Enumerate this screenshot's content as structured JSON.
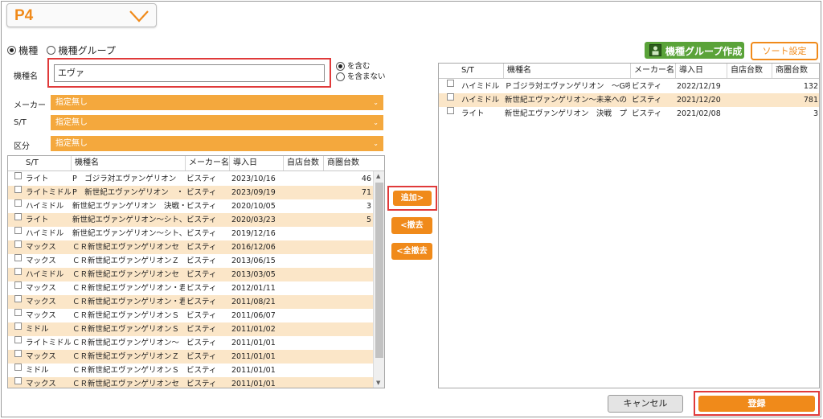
{
  "top_selector": {
    "value": "P4"
  },
  "mode": {
    "options": [
      "機種",
      "機種グループ"
    ],
    "selected": 0
  },
  "name_field": {
    "label": "機種名",
    "value": "エヴァ"
  },
  "match": {
    "options": [
      "を含む",
      "を含まない"
    ],
    "selected": 0
  },
  "filters": [
    {
      "label": "メーカー",
      "value": "指定無し"
    },
    {
      "label": "S/T",
      "value": "指定無し"
    },
    {
      "label": "区分",
      "value": "指定無し"
    }
  ],
  "left_table": {
    "columns": [
      "S/T",
      "機種名",
      "メーカー名",
      "導入日",
      "自店台数",
      "商圏台数"
    ],
    "rows": [
      [
        "ライト",
        "P　ゴジラ対エヴァンゲリオン",
        "ビスティ",
        "2023/10/16",
        "",
        "46"
      ],
      [
        "ライトミドル",
        "P　新世紀エヴァンゲリオン　・",
        "ビスティ",
        "2023/09/19",
        "",
        "71"
      ],
      [
        "ハイミドル",
        "新世紀エヴァンゲリオン　決戦・",
        "ビスティ",
        "2020/10/05",
        "",
        "3"
      ],
      [
        "ライト",
        "新世紀エヴァンゲリオン～シト、",
        "ビスティ",
        "2020/03/23",
        "",
        "5"
      ],
      [
        "ハイミドル",
        "新世紀エヴァンゲリオン～シト、",
        "ビスティ",
        "2019/12/16",
        "",
        ""
      ],
      [
        "マックス",
        "ＣＲ新世紀エヴァンゲリオンセ",
        "ビスティ",
        "2016/12/06",
        "",
        ""
      ],
      [
        "マックス",
        "ＣＲ新世紀エヴァンゲリオンＺ",
        "ビスティ",
        "2013/06/15",
        "",
        ""
      ],
      [
        "ハイミドル",
        "ＣＲ新世紀エヴァンゲリオンセ",
        "ビスティ",
        "2013/03/05",
        "",
        ""
      ],
      [
        "マックス",
        "ＣＲ新世紀エヴァンゲリオン・君",
        "ビスティ",
        "2012/01/11",
        "",
        ""
      ],
      [
        "マックス",
        "ＣＲ新世紀エヴァンゲリオン・君",
        "ビスティ",
        "2011/08/21",
        "",
        ""
      ],
      [
        "マックス",
        "ＣＲ新世紀エヴァンゲリオンＳ",
        "ビスティ",
        "2011/06/07",
        "",
        ""
      ],
      [
        "ミドル",
        "ＣＲ新世紀エヴァンゲリオンＳ",
        "ビスティ",
        "2011/01/02",
        "",
        ""
      ],
      [
        "ライトミドル",
        "ＣＲ新世紀エヴァンゲリオン～",
        "ビスティ",
        "2011/01/01",
        "",
        ""
      ],
      [
        "マックス",
        "ＣＲ新世紀エヴァンゲリオンＺ",
        "ビスティ",
        "2011/01/01",
        "",
        ""
      ],
      [
        "ミドル",
        "ＣＲ新世紀エヴァンゲリオンＳ",
        "ビスティ",
        "2011/01/01",
        "",
        ""
      ],
      [
        "マックス",
        "ＣＲ新世紀エヴァンゲリオンセ",
        "ビスティ",
        "2011/01/01",
        "",
        ""
      ]
    ]
  },
  "transfer_buttons": {
    "add": "追加>",
    "remove": "<撤去",
    "remove_all": "<全撤去"
  },
  "right_buttons": {
    "group_create": "機種グループ作成",
    "sort": "ソート設定"
  },
  "right_table": {
    "columns": [
      "S/T",
      "機種名",
      "メーカー名",
      "導入日",
      "自店台数",
      "商圏台数"
    ],
    "rows": [
      [
        "ハイミドル",
        "Ｐゴジラ対エヴァンゲリオン　～G咲",
        "ビスティ",
        "2022/12/19",
        "",
        "132"
      ],
      [
        "ハイミドル",
        "新世紀エヴァンゲリオン～未来への",
        "ビスティ",
        "2021/12/20",
        "",
        "781"
      ],
      [
        "ライト",
        "新世紀エヴァンゲリオン　決戦　プ",
        "ビスティ",
        "2021/02/08",
        "",
        "3"
      ]
    ]
  },
  "footer": {
    "cancel": "キャンセル",
    "register": "登録"
  },
  "colors": {
    "orange": "#f08a1a",
    "select_orange": "#f4a83d",
    "row_highlight": "#fbe6c8",
    "green": "#5aa339",
    "red_highlight": "#e03a3a"
  }
}
